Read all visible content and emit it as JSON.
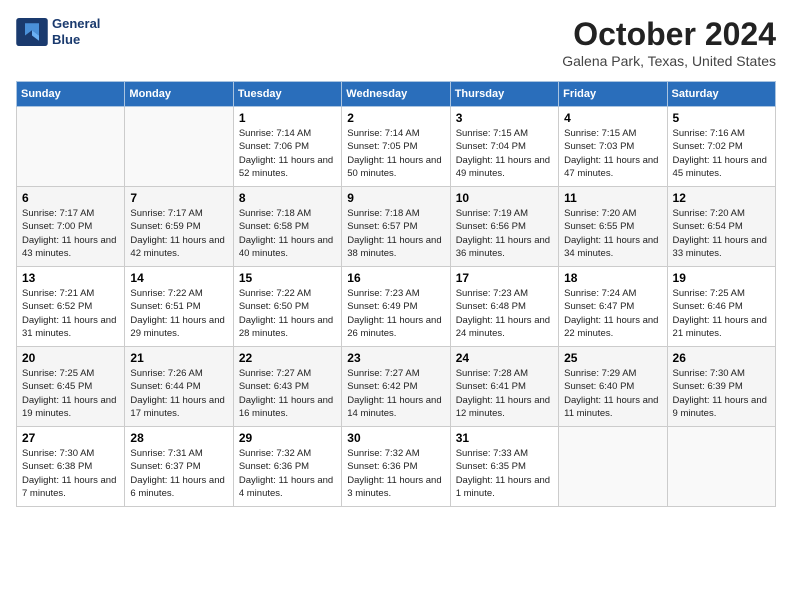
{
  "logo": {
    "line1": "General",
    "line2": "Blue"
  },
  "title": "October 2024",
  "location": "Galena Park, Texas, United States",
  "days_header": [
    "Sunday",
    "Monday",
    "Tuesday",
    "Wednesday",
    "Thursday",
    "Friday",
    "Saturday"
  ],
  "weeks": [
    [
      {
        "num": "",
        "info": ""
      },
      {
        "num": "",
        "info": ""
      },
      {
        "num": "1",
        "info": "Sunrise: 7:14 AM\nSunset: 7:06 PM\nDaylight: 11 hours and 52 minutes."
      },
      {
        "num": "2",
        "info": "Sunrise: 7:14 AM\nSunset: 7:05 PM\nDaylight: 11 hours and 50 minutes."
      },
      {
        "num": "3",
        "info": "Sunrise: 7:15 AM\nSunset: 7:04 PM\nDaylight: 11 hours and 49 minutes."
      },
      {
        "num": "4",
        "info": "Sunrise: 7:15 AM\nSunset: 7:03 PM\nDaylight: 11 hours and 47 minutes."
      },
      {
        "num": "5",
        "info": "Sunrise: 7:16 AM\nSunset: 7:02 PM\nDaylight: 11 hours and 45 minutes."
      }
    ],
    [
      {
        "num": "6",
        "info": "Sunrise: 7:17 AM\nSunset: 7:00 PM\nDaylight: 11 hours and 43 minutes."
      },
      {
        "num": "7",
        "info": "Sunrise: 7:17 AM\nSunset: 6:59 PM\nDaylight: 11 hours and 42 minutes."
      },
      {
        "num": "8",
        "info": "Sunrise: 7:18 AM\nSunset: 6:58 PM\nDaylight: 11 hours and 40 minutes."
      },
      {
        "num": "9",
        "info": "Sunrise: 7:18 AM\nSunset: 6:57 PM\nDaylight: 11 hours and 38 minutes."
      },
      {
        "num": "10",
        "info": "Sunrise: 7:19 AM\nSunset: 6:56 PM\nDaylight: 11 hours and 36 minutes."
      },
      {
        "num": "11",
        "info": "Sunrise: 7:20 AM\nSunset: 6:55 PM\nDaylight: 11 hours and 34 minutes."
      },
      {
        "num": "12",
        "info": "Sunrise: 7:20 AM\nSunset: 6:54 PM\nDaylight: 11 hours and 33 minutes."
      }
    ],
    [
      {
        "num": "13",
        "info": "Sunrise: 7:21 AM\nSunset: 6:52 PM\nDaylight: 11 hours and 31 minutes."
      },
      {
        "num": "14",
        "info": "Sunrise: 7:22 AM\nSunset: 6:51 PM\nDaylight: 11 hours and 29 minutes."
      },
      {
        "num": "15",
        "info": "Sunrise: 7:22 AM\nSunset: 6:50 PM\nDaylight: 11 hours and 28 minutes."
      },
      {
        "num": "16",
        "info": "Sunrise: 7:23 AM\nSunset: 6:49 PM\nDaylight: 11 hours and 26 minutes."
      },
      {
        "num": "17",
        "info": "Sunrise: 7:23 AM\nSunset: 6:48 PM\nDaylight: 11 hours and 24 minutes."
      },
      {
        "num": "18",
        "info": "Sunrise: 7:24 AM\nSunset: 6:47 PM\nDaylight: 11 hours and 22 minutes."
      },
      {
        "num": "19",
        "info": "Sunrise: 7:25 AM\nSunset: 6:46 PM\nDaylight: 11 hours and 21 minutes."
      }
    ],
    [
      {
        "num": "20",
        "info": "Sunrise: 7:25 AM\nSunset: 6:45 PM\nDaylight: 11 hours and 19 minutes."
      },
      {
        "num": "21",
        "info": "Sunrise: 7:26 AM\nSunset: 6:44 PM\nDaylight: 11 hours and 17 minutes."
      },
      {
        "num": "22",
        "info": "Sunrise: 7:27 AM\nSunset: 6:43 PM\nDaylight: 11 hours and 16 minutes."
      },
      {
        "num": "23",
        "info": "Sunrise: 7:27 AM\nSunset: 6:42 PM\nDaylight: 11 hours and 14 minutes."
      },
      {
        "num": "24",
        "info": "Sunrise: 7:28 AM\nSunset: 6:41 PM\nDaylight: 11 hours and 12 minutes."
      },
      {
        "num": "25",
        "info": "Sunrise: 7:29 AM\nSunset: 6:40 PM\nDaylight: 11 hours and 11 minutes."
      },
      {
        "num": "26",
        "info": "Sunrise: 7:30 AM\nSunset: 6:39 PM\nDaylight: 11 hours and 9 minutes."
      }
    ],
    [
      {
        "num": "27",
        "info": "Sunrise: 7:30 AM\nSunset: 6:38 PM\nDaylight: 11 hours and 7 minutes."
      },
      {
        "num": "28",
        "info": "Sunrise: 7:31 AM\nSunset: 6:37 PM\nDaylight: 11 hours and 6 minutes."
      },
      {
        "num": "29",
        "info": "Sunrise: 7:32 AM\nSunset: 6:36 PM\nDaylight: 11 hours and 4 minutes."
      },
      {
        "num": "30",
        "info": "Sunrise: 7:32 AM\nSunset: 6:36 PM\nDaylight: 11 hours and 3 minutes."
      },
      {
        "num": "31",
        "info": "Sunrise: 7:33 AM\nSunset: 6:35 PM\nDaylight: 11 hours and 1 minute."
      },
      {
        "num": "",
        "info": ""
      },
      {
        "num": "",
        "info": ""
      }
    ]
  ]
}
